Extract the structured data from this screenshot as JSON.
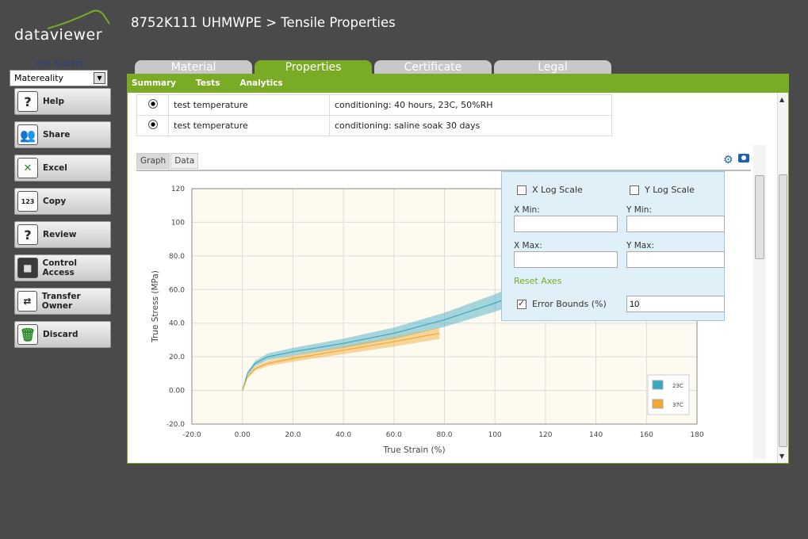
{
  "header": {
    "logo_text": "dataviewer",
    "title": "8752K111 UHMWPE > Tensile Properties"
  },
  "sidebar": {
    "unit_label": "Unit System:",
    "unit_value": "Matereality",
    "buttons": [
      {
        "label": "Help",
        "icon": "help-icon"
      },
      {
        "label": "Share",
        "icon": "share-users-icon"
      },
      {
        "label": "Excel",
        "icon": "excel-icon"
      },
      {
        "label": "Copy",
        "icon": "copy-icon"
      },
      {
        "label": "Review",
        "icon": "review-icon"
      },
      {
        "label": "Control Access",
        "icon": "lock-icon"
      },
      {
        "label": "Transfer Owner",
        "icon": "transfer-owner-icon"
      },
      {
        "label": "Discard",
        "icon": "trash-icon"
      }
    ]
  },
  "tabs": [
    "Material",
    "Properties",
    "Certificate",
    "Legal"
  ],
  "active_tab": "Properties",
  "subnav": [
    "Summary",
    "Tests",
    "Analytics"
  ],
  "conditions": [
    {
      "name": "test temperature",
      "value": "conditioning: 40 hours, 23C, 50%RH"
    },
    {
      "name": "test temperature",
      "value": "conditioning: saline soak 30 days"
    }
  ],
  "graph_tabs": [
    "Graph",
    "Data"
  ],
  "popover": {
    "x_log": "X Log Scale",
    "y_log": "Y Log Scale",
    "x_min": "X Min:",
    "y_min": "Y Min:",
    "x_max": "X Max:",
    "y_max": "Y Max:",
    "reset": "Reset Axes",
    "error_bounds": "Error Bounds (%)",
    "error_value": "10"
  },
  "colors": {
    "accent": "#7aab25",
    "series_23c": "#3aa8c1",
    "series_37c": "#f0a830"
  },
  "chart_data": {
    "type": "line",
    "xlabel": "True Strain (%)",
    "ylabel": "True Stress (MPa)",
    "xlim": [
      -20,
      180
    ],
    "ylim": [
      -20,
      120
    ],
    "xticks": [
      "-20.0",
      "0.00",
      "20.0",
      "40.0",
      "60.0",
      "80.0",
      "100",
      "120",
      "140",
      "160",
      "180"
    ],
    "yticks": [
      "-20.0",
      "0.00",
      "20.0",
      "40.0",
      "60.0",
      "80.0",
      "100",
      "120"
    ],
    "legend": "bottom-right",
    "grid": true,
    "series": [
      {
        "name": "23C",
        "color": "#3aa8c1",
        "x": [
          0,
          2,
          5,
          10,
          20,
          40,
          60,
          80,
          100,
          110
        ],
        "y": [
          0,
          10,
          16,
          20,
          23,
          28,
          34,
          42,
          52,
          58
        ]
      },
      {
        "name": "37C",
        "color": "#f0a830",
        "x": [
          0,
          2,
          5,
          10,
          20,
          40,
          60,
          78
        ],
        "y": [
          0,
          8,
          13,
          16,
          19,
          24,
          29,
          34
        ]
      }
    ]
  }
}
